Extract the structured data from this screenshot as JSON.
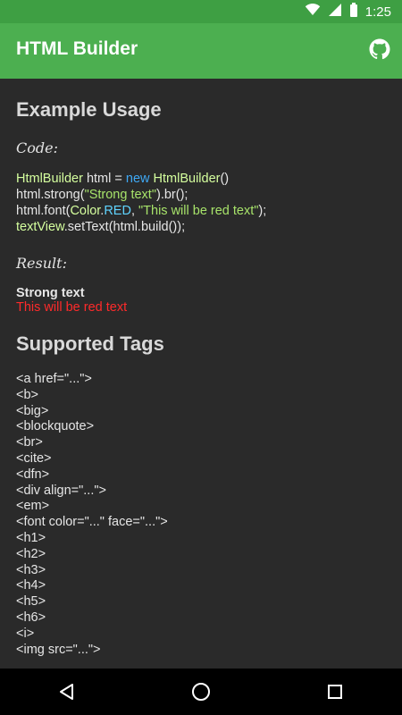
{
  "status": {
    "time": "1:25"
  },
  "app": {
    "title": "HTML Builder"
  },
  "sections": {
    "example_title": "Example Usage",
    "code_label": "Code:",
    "result_label": "Result:",
    "supported_title": "Supported Tags"
  },
  "code": {
    "line1": {
      "cls": "HtmlBuilder",
      "rest": " html = ",
      "kw": "new",
      "cls2": " HtmlBuilder",
      "end": "()"
    },
    "line2": {
      "a": "html.strong(",
      "s": "\"Strong text\"",
      "b": ").br();"
    },
    "line3": {
      "a": "html.font(",
      "cls": "Color",
      "dot": ".",
      "red": "RED",
      "b": ", ",
      "s": "\"This will be red text\"",
      "c": ");"
    },
    "line4": {
      "cls": "textView",
      "b": ".setText(html.build());"
    }
  },
  "result": {
    "strong": "Strong text",
    "red": "This will be red text"
  },
  "tags": [
    "<a href=\"...\">",
    "<b>",
    "<big>",
    "<blockquote>",
    "<br>",
    "<cite>",
    "<dfn>",
    "<div align=\"...\">",
    "<em>",
    "<font color=\"...\" face=\"...\">",
    "<h1>",
    "<h2>",
    "<h3>",
    "<h4>",
    "<h5>",
    "<h6>",
    "<i>",
    "<img src=\"...\">"
  ],
  "colors": {
    "statusbar": "#3e9f43",
    "appbar": "#4caf50",
    "background": "#2a2a2a",
    "keyword": "#3fa9f5",
    "string": "#a7e36a",
    "red_text": "#ff2a2a"
  },
  "icons": {
    "wifi": "wifi-icon",
    "signal": "signal-icon",
    "battery": "battery-icon",
    "github": "github-icon",
    "back": "back-icon",
    "home": "home-icon",
    "recents": "recents-icon"
  }
}
